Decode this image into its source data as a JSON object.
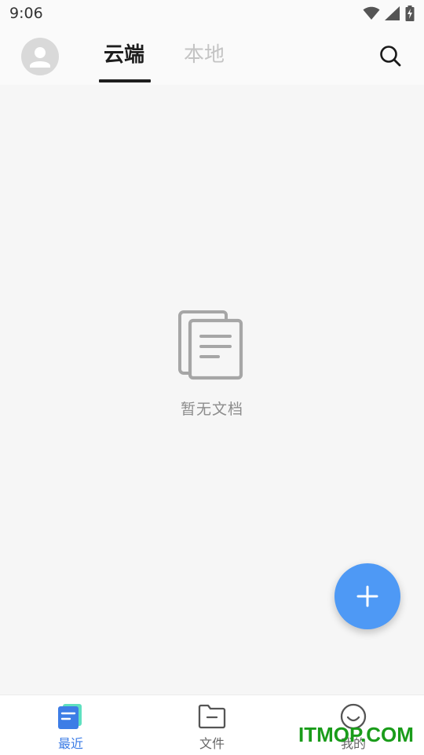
{
  "status_bar": {
    "time": "9:06",
    "icons": [
      "wifi-icon",
      "signal-icon",
      "battery-charging-icon"
    ]
  },
  "header": {
    "avatar_icon": "user-avatar-icon",
    "tabs": [
      {
        "label": "云端",
        "active": true
      },
      {
        "label": "本地",
        "active": false
      }
    ],
    "search_icon": "search-icon"
  },
  "empty_state": {
    "icon": "documents-icon",
    "text": "暂无文档"
  },
  "fab": {
    "icon": "plus-icon"
  },
  "bottom_nav": {
    "items": [
      {
        "label": "最近",
        "icon": "recent-doc-icon",
        "active": true
      },
      {
        "label": "文件",
        "icon": "folder-icon",
        "active": false
      },
      {
        "label": "我的",
        "icon": "smiley-icon",
        "active": false
      }
    ]
  },
  "watermark": {
    "text": "ITMOP.COM"
  },
  "colors": {
    "accent": "#4e99f5",
    "active_nav": "#3d7de6",
    "background": "#f6f6f6",
    "watermark": "#1a9c1a"
  }
}
